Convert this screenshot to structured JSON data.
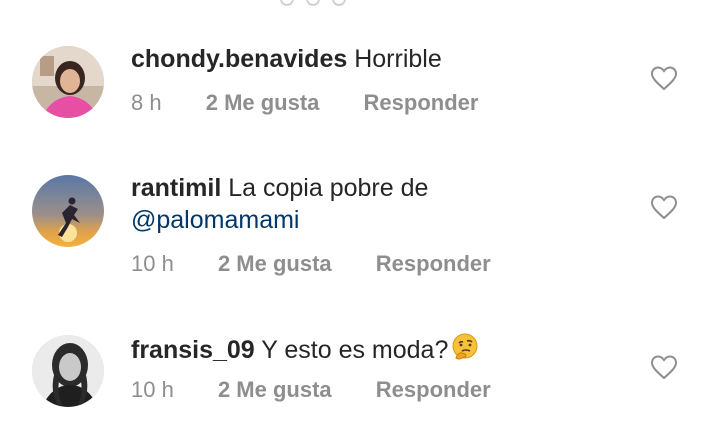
{
  "comments": [
    {
      "username": "chondy.benavides",
      "text": "Horrible",
      "mention": "",
      "time": "8 h",
      "likes": "2 Me gusta",
      "reply": "Responder"
    },
    {
      "username": "rantimil",
      "text": "La copia pobre de",
      "mention": "@palomamami",
      "time": "10 h",
      "likes": "2 Me gusta",
      "reply": "Responder"
    },
    {
      "username": "fransis_09",
      "text": "Y esto es moda?",
      "mention": "",
      "time": "10 h",
      "likes": "2 Me gusta",
      "reply": "Responder"
    }
  ],
  "icons": {
    "like": "heart-outline-icon",
    "emoji": "thinking-face-emoji"
  },
  "colors": {
    "text": "#262626",
    "meta": "#8e8e8e",
    "mention": "#00376b"
  }
}
